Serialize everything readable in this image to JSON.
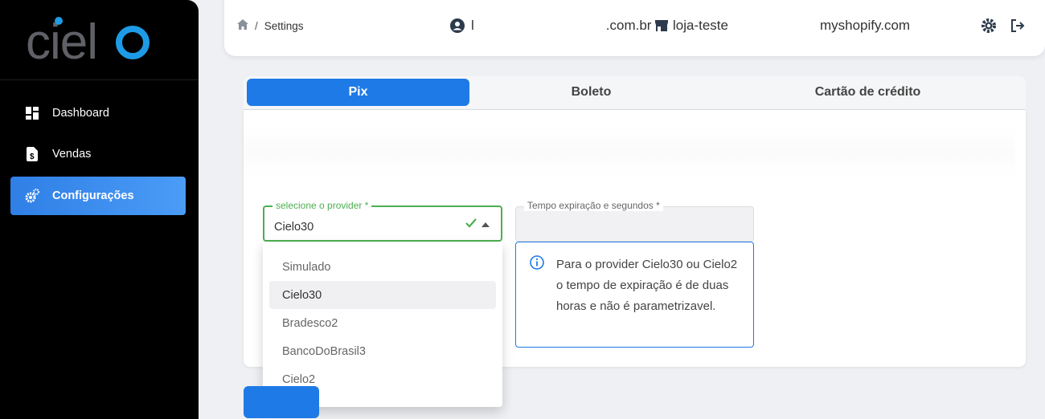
{
  "brand": {
    "logo_text": "cielo",
    "accent": "#1e7ae6"
  },
  "sidebar": {
    "items": [
      {
        "label": "Dashboard",
        "icon": "dashboard-icon"
      },
      {
        "label": "Vendas",
        "icon": "receipt-dollar-icon"
      },
      {
        "label": "Configurações",
        "icon": "gears-icon",
        "active": true
      }
    ]
  },
  "header": {
    "breadcrumb_home_icon": "home-icon",
    "breadcrumb_sep": "/",
    "breadcrumb_page": "Settings",
    "user_prefix": "l",
    "user_domain": ".com.br",
    "store_prefix": "loja-teste",
    "store_suffix": "myshopify.com"
  },
  "tabs": [
    {
      "label": "Pix",
      "active": true
    },
    {
      "label": "Boleto",
      "active": false
    },
    {
      "label": "Cartão de crédito",
      "active": false
    }
  ],
  "form": {
    "provider_label": "selecione o provider *",
    "provider_value": "Cielo30",
    "expiration_label": "Tempo expiração e segundos *",
    "expiration_value": ""
  },
  "dropdown": {
    "options": [
      "Simulado",
      "Cielo30",
      "Bradesco2",
      "BancoDoBrasil3",
      "Cielo2"
    ],
    "selected": "Cielo30"
  },
  "info": {
    "text": "Para o provider Cielo30 ou Cielo2 o tempo de expiração é de duas horas e não é parametrizavel."
  }
}
